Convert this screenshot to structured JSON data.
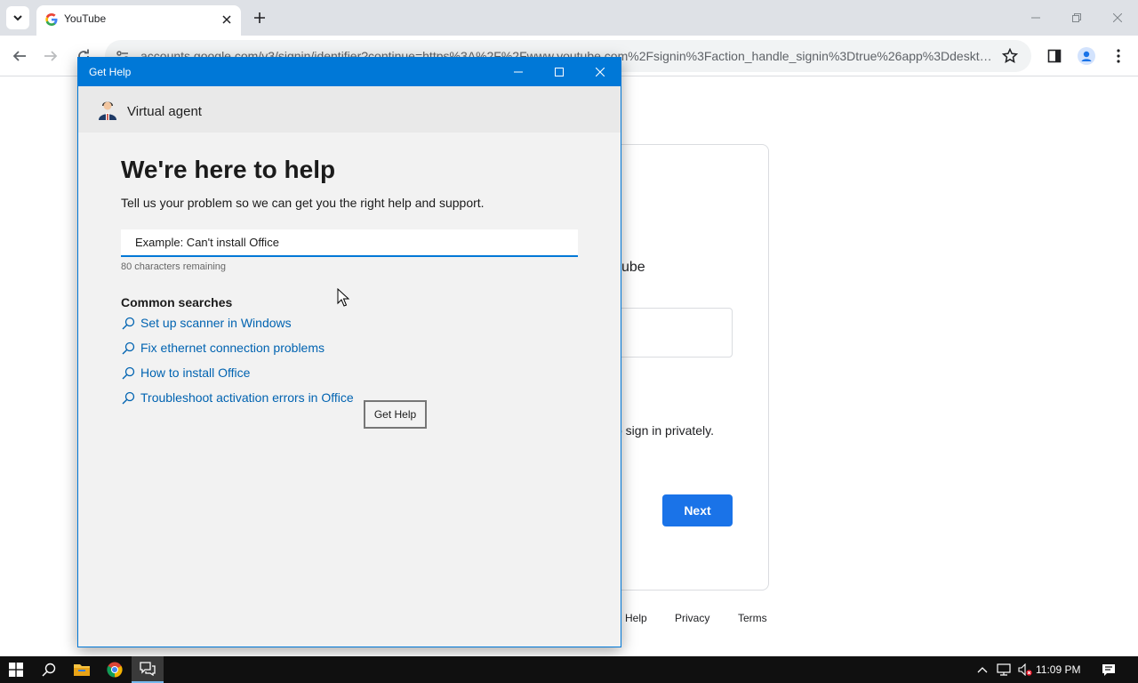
{
  "browser": {
    "tab_title": "YouTube",
    "url": "accounts.google.com/v3/signin/identifier?continue=https%3A%2F%2Fwww.youtube.com%2Fsignin%3Faction_handle_signin%3Dtrue%26app%3Ddesktop..."
  },
  "signin_page": {
    "partial_subtitle": "ube",
    "partial_note": "o sign in privately.",
    "next_label": "Next",
    "footer": {
      "help": "Help",
      "privacy": "Privacy",
      "terms": "Terms"
    }
  },
  "get_help": {
    "window_title": "Get Help",
    "agent_label": "Virtual agent",
    "heading": "We're here to help",
    "subheading": "Tell us your problem so we can get you the right help and support.",
    "input_placeholder": "Example: Can't install Office",
    "chars_remaining": "80 characters remaining",
    "common_searches_label": "Common searches",
    "common_searches": [
      "Set up scanner in Windows",
      "Fix ethernet connection problems",
      "How to install Office",
      "Troubleshoot activation errors in Office"
    ],
    "tooltip": "Get Help"
  },
  "taskbar": {
    "clock": "11:09 PM"
  },
  "colors": {
    "win_accent": "#0078d7",
    "link": "#0063b1",
    "google_blue": "#1a73e8"
  }
}
